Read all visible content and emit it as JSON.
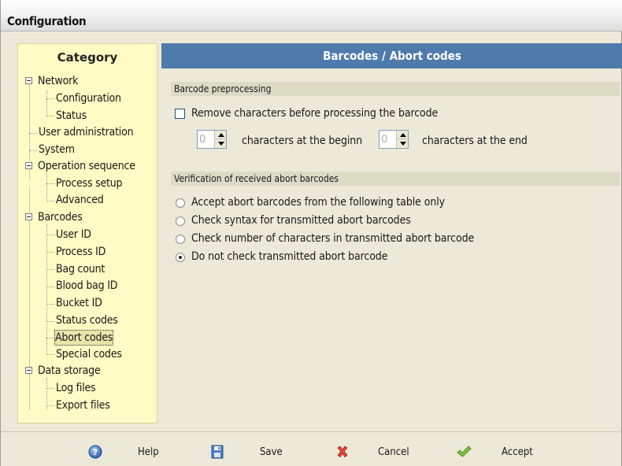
{
  "window": {
    "title": "Configuration"
  },
  "category": {
    "header": "Category",
    "tree": [
      {
        "label": "Network"
      },
      {
        "label": "Configuration"
      },
      {
        "label": "Status"
      },
      {
        "label": "User administration"
      },
      {
        "label": "System"
      },
      {
        "label": "Operation sequence"
      },
      {
        "label": "Process setup"
      },
      {
        "label": "Advanced"
      },
      {
        "label": "Barcodes"
      },
      {
        "label": "User ID"
      },
      {
        "label": "Process ID"
      },
      {
        "label": "Bag count"
      },
      {
        "label": "Blood bag ID"
      },
      {
        "label": "Bucket ID"
      },
      {
        "label": "Status codes"
      },
      {
        "label": "Abort codes"
      },
      {
        "label": "Special codes"
      },
      {
        "label": "Data storage"
      },
      {
        "label": "Log files"
      },
      {
        "label": "Export files"
      }
    ],
    "selected": "Abort codes"
  },
  "content": {
    "header": "Barcodes / Abort codes",
    "preprocessing": {
      "group_label": "Barcode preprocessing",
      "remove_checkbox_label": "Remove characters before processing the barcode",
      "remove_checked": false,
      "begin_value": "0",
      "begin_label": "characters at the beginn",
      "end_value": "0",
      "end_label": "characters at the end"
    },
    "verification": {
      "group_label": "Verification of received abort barcodes",
      "options": [
        {
          "label": "Accept abort barcodes from the following table only",
          "checked": false
        },
        {
          "label": "Check syntax for transmitted abort barcodes",
          "checked": false
        },
        {
          "label": "Check number of characters in transmitted abort barcode",
          "checked": false
        },
        {
          "label": "Do not check transmitted abort barcode",
          "checked": true
        }
      ]
    }
  },
  "footer": {
    "help_label": "Help",
    "save_label": "Save",
    "cancel_label": "Cancel",
    "accept_label": "Accept"
  },
  "colors": {
    "category_bg": "#fefcc4",
    "header_bg": "#4e7bac",
    "group_band_bg": "#dcdbc6"
  }
}
